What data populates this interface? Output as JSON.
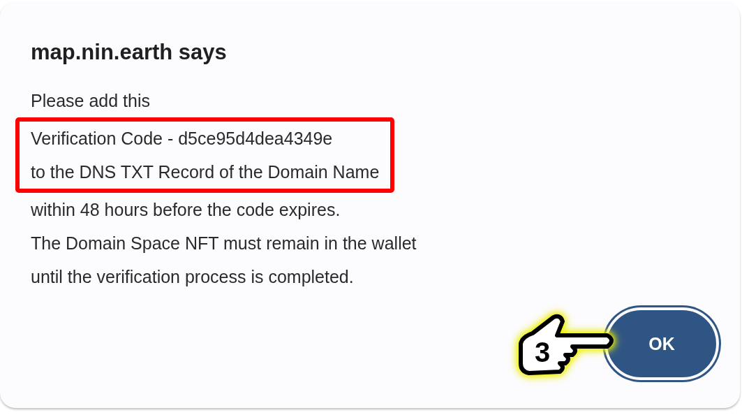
{
  "dialog": {
    "title": "map.nin.earth says",
    "message_blocks": [
      {
        "kind": "plain",
        "lines": [
          "Please add this"
        ]
      },
      {
        "kind": "highlighted",
        "lines": [
          "Verification Code - d5ce95d4dea4349e",
          "to the DNS TXT Record of the Domain Name"
        ]
      },
      {
        "kind": "plain",
        "lines": [
          "within 48 hours before the code expires.",
          "The Domain Space NFT must remain in the wallet",
          "until the verification process is completed."
        ]
      }
    ],
    "callout": {
      "number": "3"
    },
    "buttons": [
      "OK"
    ]
  }
}
